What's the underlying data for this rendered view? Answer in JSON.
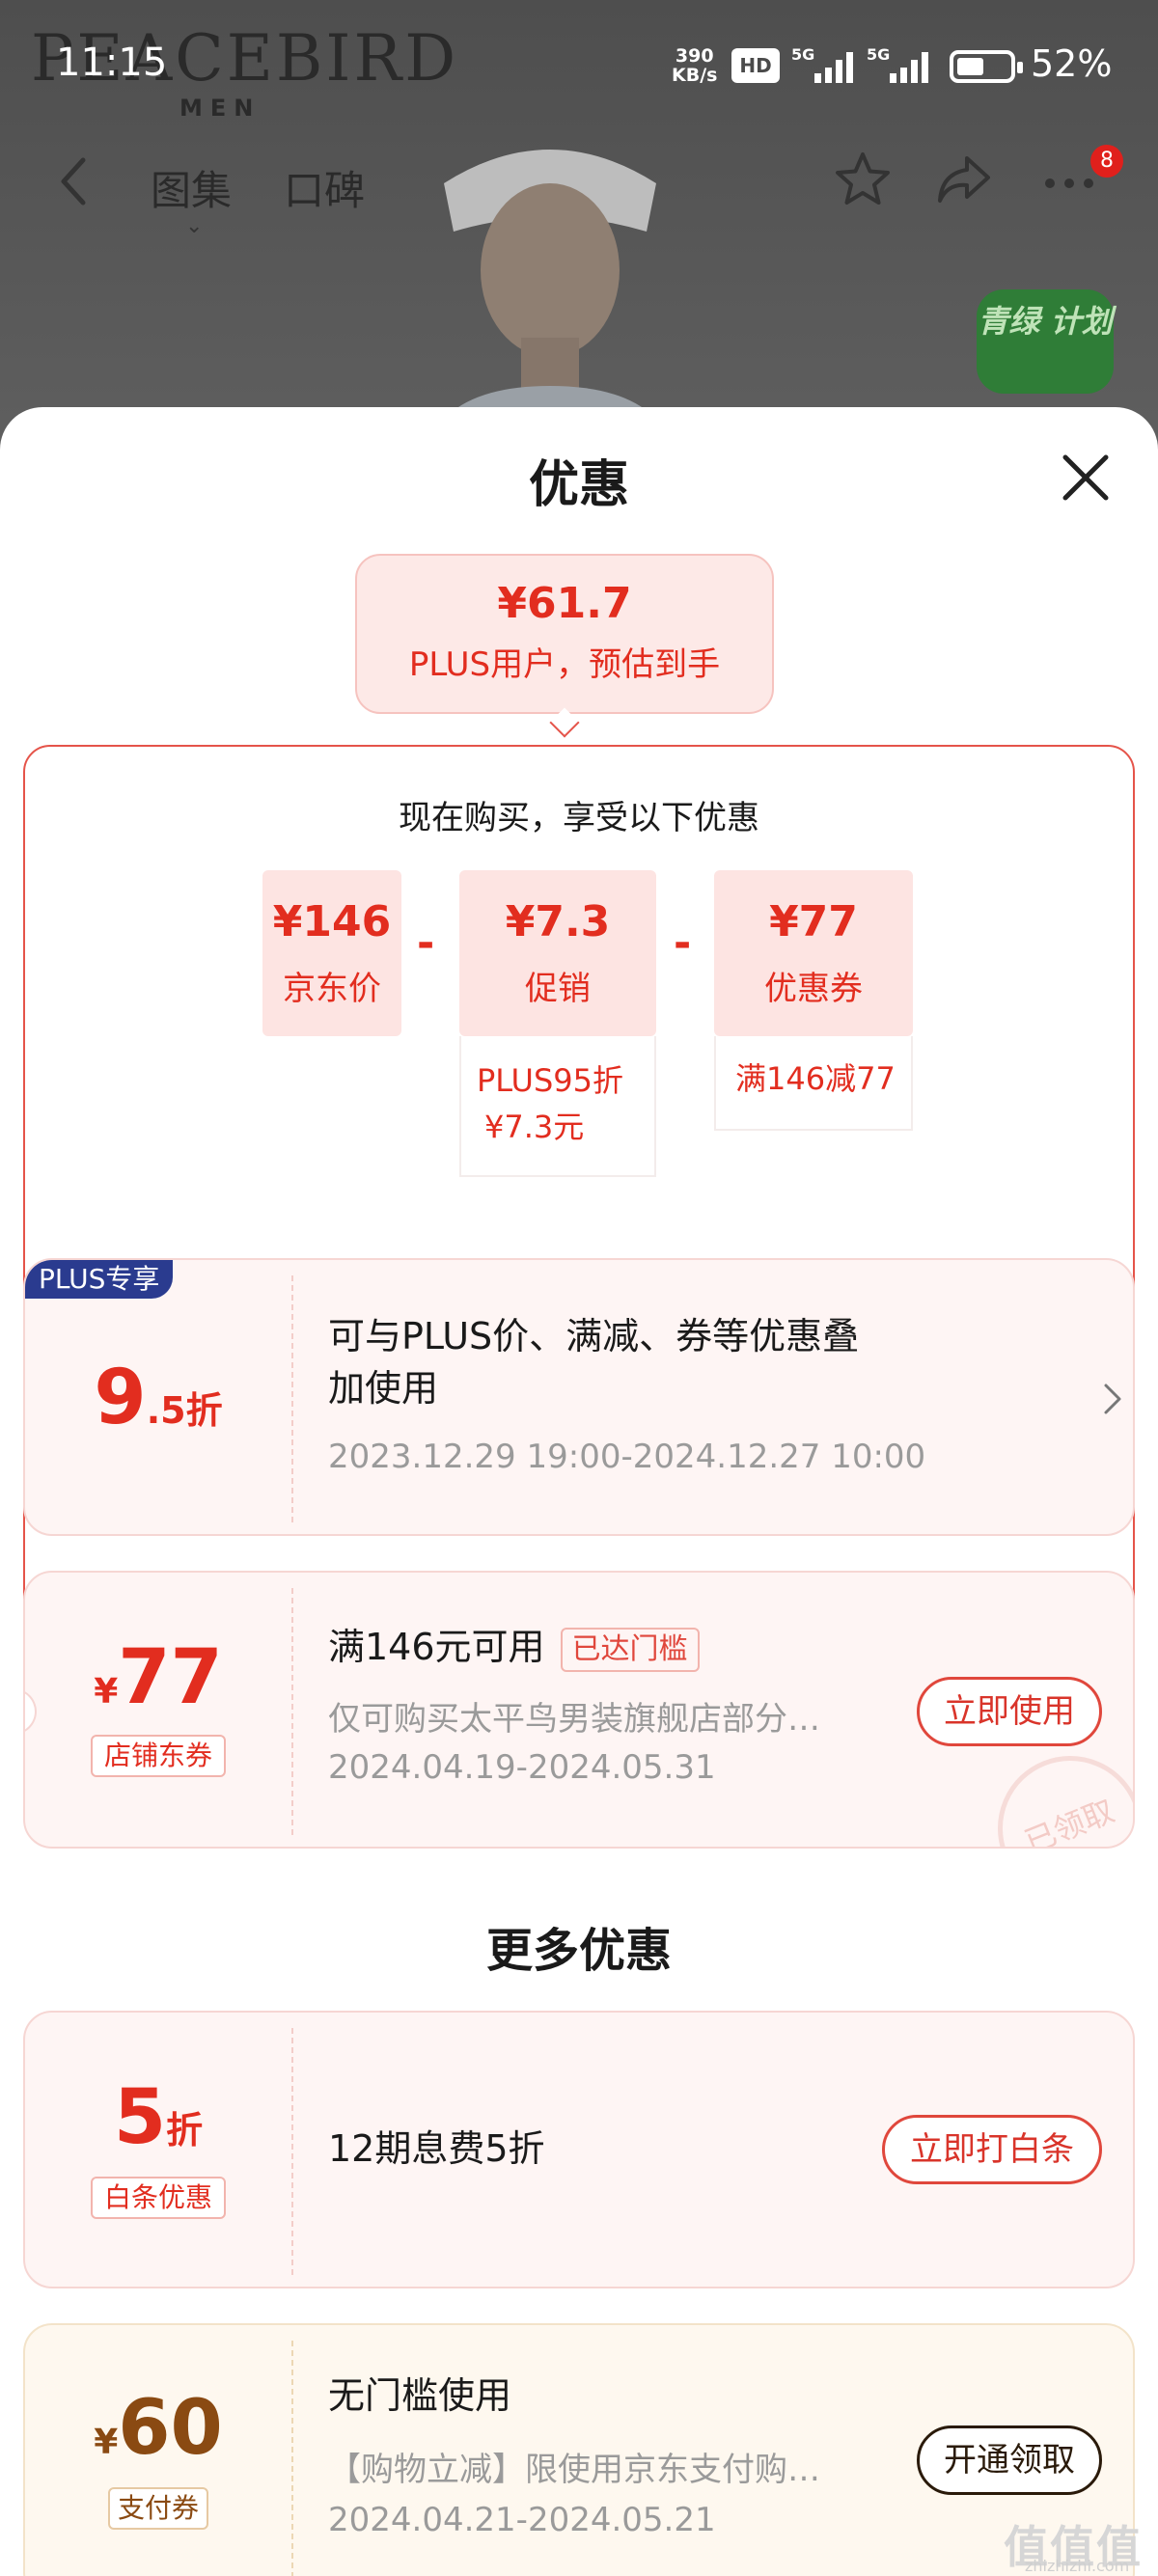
{
  "status": {
    "time": "11:15",
    "net_speed_value": "390",
    "net_speed_unit": "KB/s",
    "hd": "HD",
    "sig1": "5G",
    "sig2": "5G",
    "battery_level": 0.52,
    "battery": "52%"
  },
  "background": {
    "brand": "PEACEBIRD",
    "brand_sub": "MEN",
    "green_badge": "青绿 计划"
  },
  "nav": {
    "tabs": [
      "图集",
      "口碑"
    ],
    "message_badge": "8"
  },
  "sheet": {
    "title": "优惠"
  },
  "estimate": {
    "price": "¥61.7",
    "label": "PLUS用户，预估到手"
  },
  "calc": {
    "heading": "现在购买，享受以下优惠",
    "cells": [
      {
        "value": "¥146",
        "label": "京东价"
      },
      {
        "value": "¥7.3",
        "label": "促销",
        "note_lines": [
          "PLUS95折",
          "¥7.3元"
        ]
      },
      {
        "value": "¥77",
        "label": "优惠券",
        "note_lines": [
          "满146减77"
        ]
      }
    ],
    "op": "-"
  },
  "coupons": [
    {
      "tag": "PLUS专享",
      "big_main": "9",
      "big_sub": ".5折",
      "title_lines": [
        "可与PLUS价、满减、券等优惠叠",
        "加使用"
      ],
      "date": "2023.12.29 19:00-2024.12.27 10:00"
    },
    {
      "big_currency": "¥",
      "big_main": "77",
      "type_tag": "店铺东券",
      "title": "满146元可用",
      "badge": "已达门槛",
      "desc": "仅可购买太平鸟男装旗舰店部分…",
      "date": "2024.04.19-2024.05.31",
      "button": "立即使用",
      "stamp": "已领取"
    }
  ],
  "more": {
    "heading": "更多优惠",
    "items": [
      {
        "big_main": "5",
        "big_sub": "折",
        "type_tag": "白条优惠",
        "title": "12期息费5折",
        "button": "立即打白条"
      },
      {
        "big_currency": "¥",
        "big_main": "60",
        "type_tag": "支付券",
        "title": "无门槛使用",
        "desc": "【购物立减】限使用京东支付购…",
        "date": "2024.04.21-2024.05.21",
        "button": "开通领取"
      }
    ]
  },
  "watermark": {
    "main": "值值值",
    "sub": "zhizhizhi.com"
  }
}
